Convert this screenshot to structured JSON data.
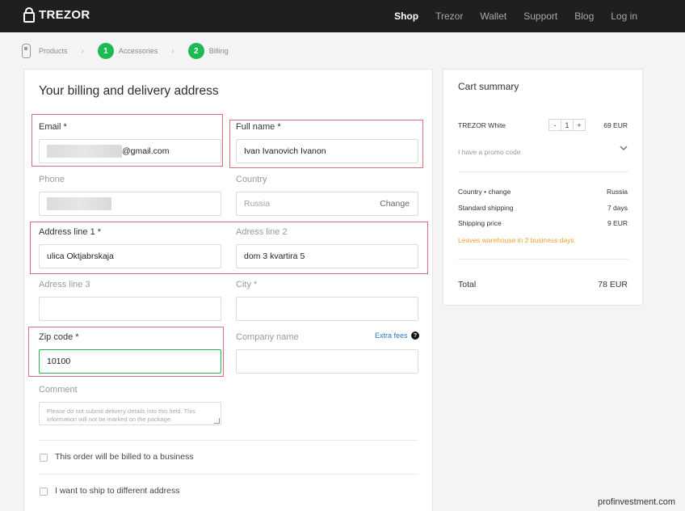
{
  "brand": {
    "name": "TREZOR"
  },
  "nav": {
    "items": [
      {
        "label": "Shop",
        "active": true
      },
      {
        "label": "Trezor",
        "active": false
      },
      {
        "label": "Wallet",
        "active": false
      },
      {
        "label": "Support",
        "active": false
      },
      {
        "label": "Blog",
        "active": false
      },
      {
        "label": "Log in",
        "active": false
      }
    ]
  },
  "steps": {
    "products": "Products",
    "accessories_num": "1",
    "accessories": "Accessories",
    "billing_num": "2",
    "billing": "Billing"
  },
  "form": {
    "title": "Your billing and delivery address",
    "email": {
      "label": "Email *",
      "value_suffix": "@gmail.com"
    },
    "full_name": {
      "label": "Full name *",
      "value": "Ivan Ivanovich Ivanon"
    },
    "phone": {
      "label": "Phone"
    },
    "country": {
      "label": "Country",
      "value": "Russia",
      "action": "Change"
    },
    "address1": {
      "label": "Address line 1 *",
      "value": "ulica Oktjabrskaja"
    },
    "address2": {
      "label": "Adress line 2",
      "value": "dom 3 kvartira 5"
    },
    "address3": {
      "label": "Adress line 3",
      "value": ""
    },
    "city": {
      "label": "City *",
      "value": ""
    },
    "zip": {
      "label": "Zip code *",
      "value": "10100"
    },
    "company": {
      "label": "Company name",
      "extra_fees": "Extra fees",
      "help": "?"
    },
    "comment": {
      "label": "Comment",
      "placeholder": "Please do not submit delivery details into this field. This information will not be marked on the package."
    },
    "business_checkbox": "This order will be billed to a business",
    "ship_checkbox": "I want to ship to different address"
  },
  "cart": {
    "title": "Cart summary",
    "item_name": "TREZOR White",
    "qty_minus": "-",
    "qty_value": "1",
    "qty_plus": "+",
    "item_price": "69 EUR",
    "promo": "I have a promo code",
    "country_label": "Country • change",
    "country_value": "Russia",
    "shipping_label": "Standard shipping",
    "shipping_value": "7 days",
    "shipping_price_label": "Shipping price",
    "shipping_price_value": "9 EUR",
    "warehouse_note": "Leaves warehouse in 2 business days.",
    "total_label": "Total",
    "total_value": "78 EUR"
  },
  "watermark": "profinvestment.com",
  "colors": {
    "accent": "#1db954",
    "highlight": "#d9707a",
    "link": "#2a7ab8",
    "warning": "#f0a032",
    "topbar": "#1f1f1f"
  }
}
